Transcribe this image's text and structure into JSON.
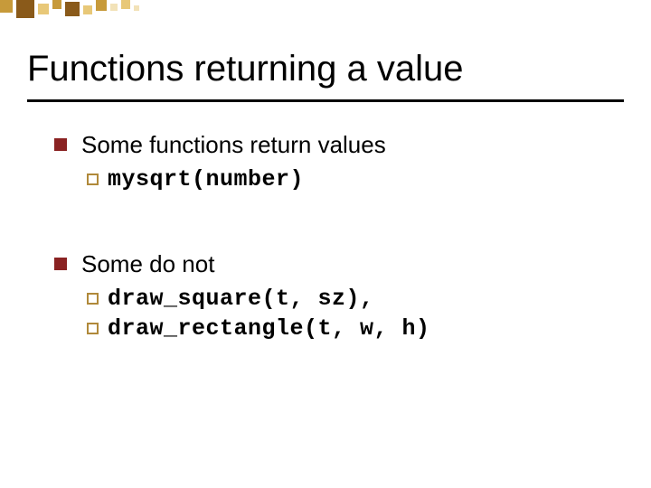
{
  "title": "Functions returning a value",
  "items": [
    {
      "text": "Some functions return values",
      "subs": [
        {
          "code": "mysqrt(number)"
        }
      ]
    },
    {
      "text": "Some do not",
      "subs": [
        {
          "code": "draw_square(t, sz),"
        },
        {
          "code": "draw_rectangle(t, w, h)"
        }
      ]
    }
  ],
  "deco_colors": {
    "dark": "#8a5a1a",
    "mid": "#c79a3a",
    "light": "#e8c878",
    "pale": "#f2e2b8"
  }
}
